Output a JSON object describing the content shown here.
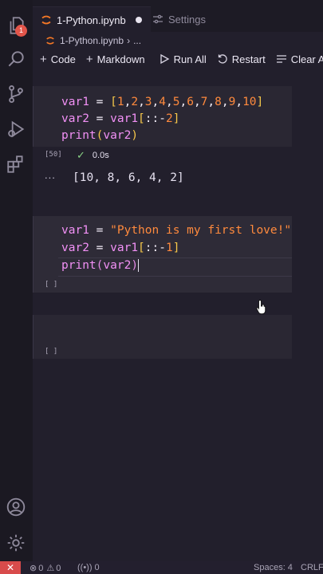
{
  "tabs": [
    {
      "label": "1-Python.ipynb",
      "dirty": true
    },
    {
      "label": "Settings"
    }
  ],
  "breadcrumb": {
    "file": "1-Python.ipynb",
    "more": "..."
  },
  "toolbar": {
    "code": "Code",
    "markdown": "Markdown",
    "run_all": "Run All",
    "restart": "Restart",
    "clear": "Clear A"
  },
  "activity": {
    "badge": "1"
  },
  "cells": [
    {
      "exec_count": "[50]",
      "status_time": "0.0s",
      "output_marker": "...",
      "output": "[10, 8, 6, 4, 2]"
    },
    {
      "exec_count": "[ ]"
    },
    {
      "exec_count": "[ ]"
    }
  ],
  "statusbar": {
    "errors": "0",
    "warnings": "0",
    "ports": "0",
    "spaces": "Spaces: 4",
    "eol": "CRLF"
  },
  "colors": {
    "accent": "#e2554a",
    "keyword": "#f291f6",
    "number": "#ff8a3d",
    "bracket": "#f7c84a",
    "success": "#89d185"
  }
}
